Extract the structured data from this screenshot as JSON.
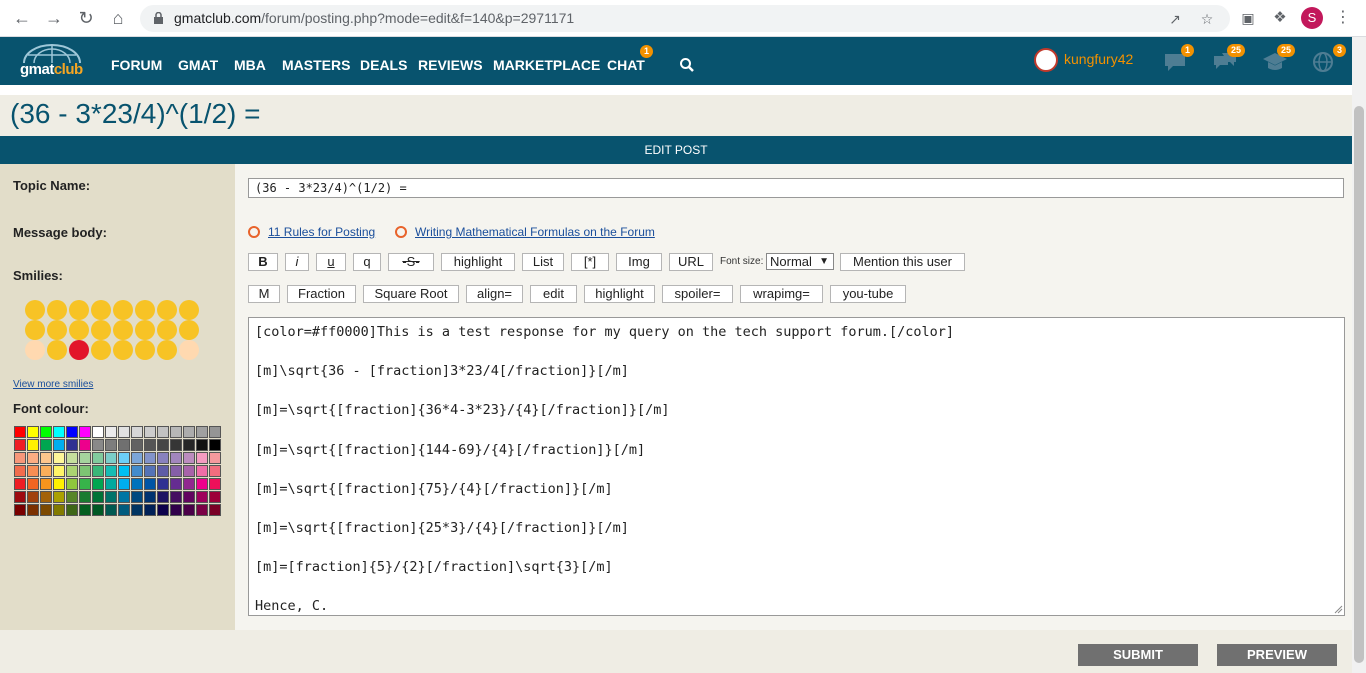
{
  "browser": {
    "url_domain": "gmatclub.com",
    "url_path": "/forum/posting.php?mode=edit&f=140&p=2971171",
    "profile_initial": "S"
  },
  "header": {
    "logo_text_1": "gmat",
    "logo_text_2": "club",
    "nav": [
      {
        "label": "FORUM"
      },
      {
        "label": "GMAT"
      },
      {
        "label": "MBA"
      },
      {
        "label": "MASTERS"
      },
      {
        "label": "DEALS"
      },
      {
        "label": "REVIEWS"
      },
      {
        "label": "MARKETPLACE"
      },
      {
        "label": "CHAT",
        "badge": "1"
      }
    ],
    "username": "kungfury42",
    "badges": {
      "chat": "1",
      "messages": "25",
      "school": "25",
      "global": "3"
    }
  },
  "page_title": "(36 - 3*23/4)^(1/2) =",
  "edit_bar": "EDIT POST",
  "form": {
    "topic_label": "Topic Name:",
    "topic_value": "(36 - 3*23/4)^(1/2) =",
    "body_label": "Message body:",
    "smilies_label": "Smilies:",
    "view_more": "View more smilies",
    "font_colour_label": "Font colour:",
    "rules_link": "11 Rules for Posting",
    "formula_link": "Writing Mathematical Formulas on the Forum",
    "toolbar_row1": [
      "B",
      "i",
      "u",
      "q",
      "-S-",
      "highlight",
      "List",
      "[*]",
      "Img",
      "URL"
    ],
    "font_size_label": "Font size:",
    "font_size_value": "Normal",
    "mention_label": "Mention this user",
    "toolbar_row2": [
      "M",
      "Fraction",
      "Square Root",
      "align=",
      "edit",
      "highlight",
      "spoiler=",
      "wrapimg=",
      "you-tube"
    ],
    "message_lines": [
      "[color=#ff0000]This is a test response for my query on the tech support forum.[/color]",
      "[m]\\sqrt{36 - [fraction]3*23/4[/fraction]}[/m]",
      "[m]=\\sqrt{[fraction]{36*4-3*23}/{4}[/fraction]}[/m]",
      "[m]=\\sqrt{[fraction]{144-69}/{4}[/fraction]}[/m]",
      "[m]=\\sqrt{[fraction]{75}/{4}[/fraction]}[/m]",
      "[m]=\\sqrt{[fraction]{25*3}/{4}[/fraction]}[/m]",
      "[m]=[fraction]{5}/{2}[/fraction]\\sqrt{3}[/m]",
      "Hence, C."
    ],
    "submit_label": "SUBMIT",
    "preview_label": "PREVIEW"
  },
  "colors": {
    "nav_bg": "#08536e",
    "accent": "#f29100",
    "link": "#1a4e9b"
  }
}
